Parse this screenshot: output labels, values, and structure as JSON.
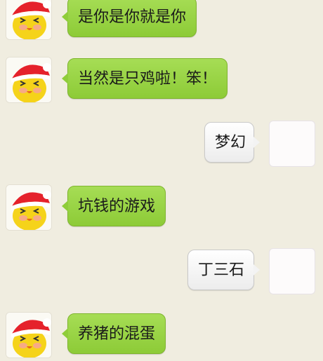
{
  "messages": [
    {
      "side": "left",
      "text": "是你是你就是你"
    },
    {
      "side": "left",
      "text": "当然是只鸡啦！笨！"
    },
    {
      "side": "right",
      "text": "梦幻"
    },
    {
      "side": "left",
      "text": "坑钱的游戏"
    },
    {
      "side": "right",
      "text": "丁三石"
    },
    {
      "side": "left",
      "text": "养猪的混蛋"
    }
  ],
  "icons": {
    "left_avatar": "yellow-chick-santa-hat-avatar-icon",
    "right_avatar": "blank-avatar-icon"
  },
  "colors": {
    "background": "#f0ede0",
    "bubble_left": "#97d244",
    "bubble_right": "#f4f4f4"
  }
}
